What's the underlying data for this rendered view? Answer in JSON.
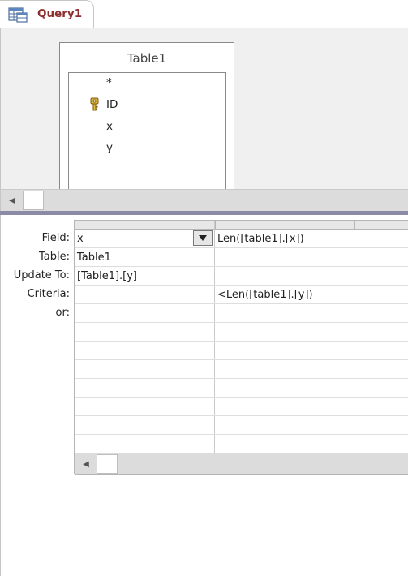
{
  "tab": {
    "label": "Query1",
    "icon": "query-design-icon"
  },
  "table": {
    "title": "Table1",
    "fields": [
      "*",
      "ID",
      "x",
      "y"
    ],
    "primary_key": "ID"
  },
  "grid": {
    "row_labels": [
      "Field:",
      "Table:",
      "Update To:",
      "Criteria:",
      "or:"
    ],
    "columns": [
      {
        "field": "x",
        "table": "Table1",
        "update_to": "[Table1].[y]",
        "criteria": ""
      },
      {
        "field": "Len([table1].[x])",
        "table": "",
        "update_to": "",
        "criteria": "<Len([table1].[y])"
      },
      {
        "field": "",
        "table": "",
        "update_to": "",
        "criteria": ""
      }
    ]
  },
  "colors": {
    "tab_text": "#8e2f2f",
    "splitter": "#8b8ba6",
    "pane_bg": "#f0f0f0"
  }
}
